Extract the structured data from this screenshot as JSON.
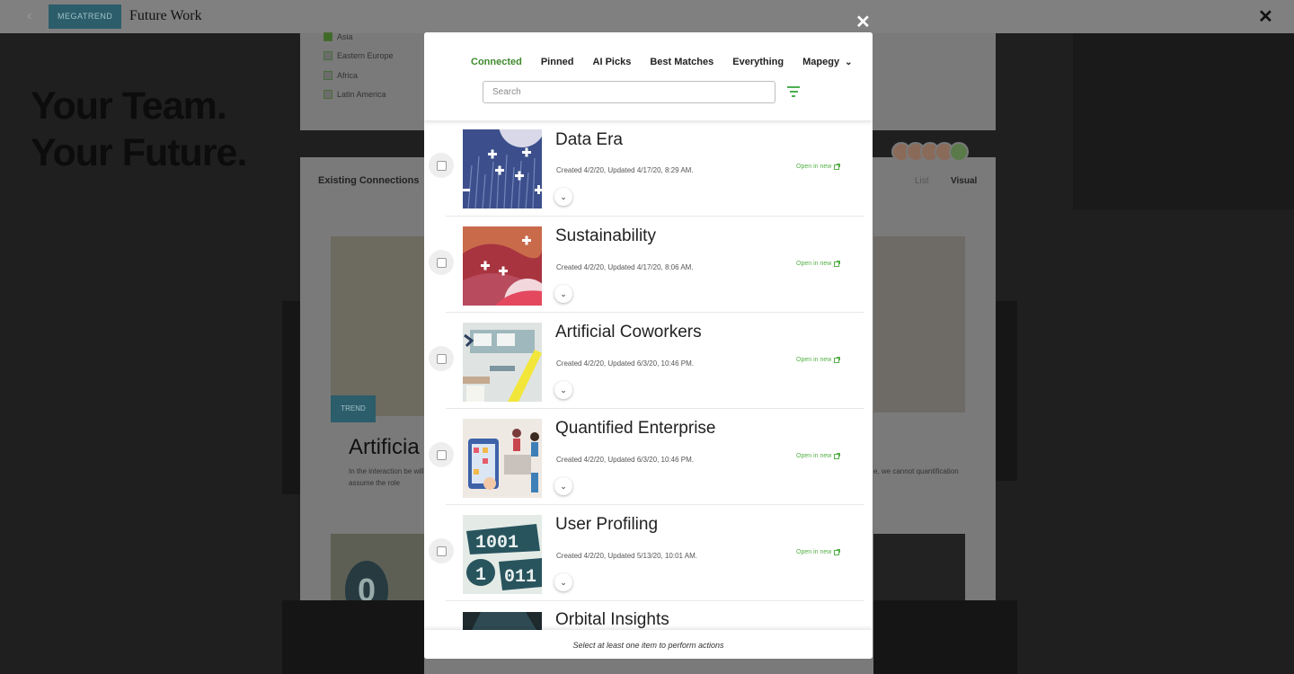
{
  "app": {
    "badge": "MEGATREND",
    "title": "Future Work"
  },
  "background": {
    "hero_line1": "Your Team.",
    "hero_line2": "Your Future.",
    "regions": [
      {
        "label": "Asia",
        "checked": true
      },
      {
        "label": "Eastern Europe",
        "checked": false
      },
      {
        "label": "Africa",
        "checked": false
      },
      {
        "label": "Latin America",
        "checked": false
      }
    ],
    "existing_connections": "Existing Connections",
    "view_list": "List",
    "view_visual": "Visual",
    "trend_tag": "TREND",
    "card_title": "Artificia",
    "card_text": "In the interaction be will assume the role",
    "right_text": "e, we cannot quantification"
  },
  "modal": {
    "tabs": [
      {
        "label": "Connected",
        "active": true
      },
      {
        "label": "Pinned",
        "active": false
      },
      {
        "label": "AI Picks",
        "active": false
      },
      {
        "label": "Best Matches",
        "active": false
      },
      {
        "label": "Everything",
        "active": false
      }
    ],
    "dropdown_label": "Mapegy",
    "search_placeholder": "Search",
    "items": [
      {
        "title": "Data Era",
        "meta": "Created 4/2/20, Updated 4/17/20, 8:29 AM.",
        "open_label": "Open in new"
      },
      {
        "title": "Sustainability",
        "meta": "Created 4/2/20, Updated 4/17/20, 8:06 AM.",
        "open_label": "Open in new"
      },
      {
        "title": "Artificial Coworkers",
        "meta": "Created 4/2/20, Updated 6/3/20, 10:46 PM.",
        "open_label": "Open in new"
      },
      {
        "title": "Quantified Enterprise",
        "meta": "Created 4/2/20, Updated 6/3/20, 10:46 PM.",
        "open_label": "Open in new"
      },
      {
        "title": "User Profiling",
        "meta": "Created 4/2/20, Updated 5/13/20, 10:01 AM.",
        "open_label": "Open in new"
      },
      {
        "title": "Orbital Insights",
        "meta": "",
        "open_label": ""
      }
    ],
    "thumb_text": {
      "user_profiling_top": "1001",
      "user_profiling_bottom": "011",
      "user_profiling_one": "1"
    },
    "footer": "Select at least one item to perform actions"
  },
  "colors": {
    "accent": "#3e8a2e",
    "link": "#55b047",
    "badge_bg": "#2c5d6a"
  }
}
